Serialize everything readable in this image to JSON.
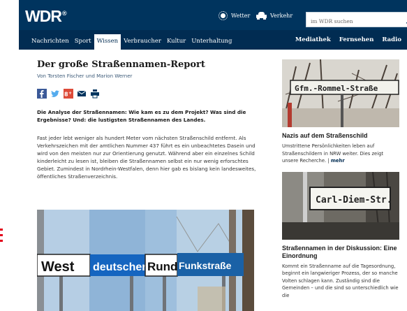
{
  "header": {
    "logo_text": "WDR",
    "logo_mark": "®",
    "weather_label": "Wetter",
    "traffic_label": "Verkehr",
    "search_placeholder": "im WDR suchen"
  },
  "nav": {
    "left_items": [
      "Nachrichten",
      "Sport",
      "Wissen",
      "Verbraucher",
      "Kultur",
      "Unterhaltung"
    ],
    "active_item": "Wissen",
    "right_items": [
      "Mediathek",
      "Fernsehen",
      "Radio"
    ]
  },
  "article": {
    "title": "Der große Straßennamen-Report",
    "byline": "Von Torsten Fischer und Marion Werner",
    "share_icons": [
      "facebook-icon",
      "twitter-icon",
      "google-plus-icon",
      "email-icon",
      "print-icon"
    ],
    "lead": "Die Analyse der Straßennamen: Wie kam es zu dem Projekt? Was sind die Ergebnisse? Und: die lustigsten Straßennamen des Landes.",
    "body": "Fast jeder lebt weniger als hundert Meter vom nächsten Straßenschild entfernt. Als Verkehrszeichen mit der amtlichen Nummer 437 führt es ein unbeachtetes Dasein und wird von den meisten nur zur Orientierung genutzt. Während aber ein einzelnes Schild kinderleicht zu lesen ist, bleiben die Straßennamen selbst ein nur wenig erforschtes Gebiet. Zumindest in Nordrhein-Westfalen, denn hier gab es bislang kein landesweites, öffentliches Straßenverzeichnis.",
    "hero_signs": [
      "West",
      "deutscher",
      "Rund",
      "Funkstraße"
    ]
  },
  "sidebar": {
    "teaser1": {
      "sign_text": "Gfm.-Rommel-Straße",
      "title": "Nazis auf dem Straßenschild",
      "text": "Umstrittene Persönlichkeiten leben auf Straßenschildern in NRW weiter. Dies zeigt unsere Recherche.",
      "separator": "|",
      "more": "mehr"
    },
    "teaser2": {
      "sign_text": "Carl-Diem-Str.",
      "title": "Straßennamen in der Diskussion: Eine Einordnung",
      "text": "Kommt ein Straßenname auf die Tagesordnung, beginnt ein langwieriger Prozess, der so manche Volten schlagen kann. Zuständig sind die Gemeinden – und die sind so unterschiedlich wie die"
    }
  },
  "colors": {
    "header_bg": "#00345e",
    "nav_bg": "#012c52",
    "accent_red": "#e3001b",
    "link": "#012c52"
  }
}
